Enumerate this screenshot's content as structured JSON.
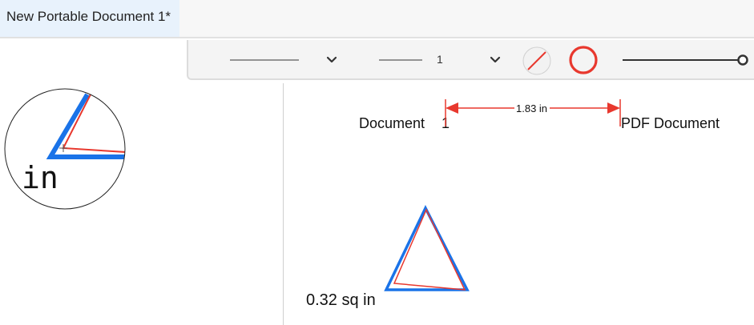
{
  "tab": {
    "title": "New Portable Document 1*"
  },
  "toolbar": {
    "line_width_value": "1",
    "stroke_color": "#e8382e",
    "border_color": "#e8382e"
  },
  "magnifier": {
    "label": "in"
  },
  "document": {
    "text_left": "Document",
    "text_mid_char": "1",
    "text_right": "PDF Document",
    "measure_label": "1.83 in",
    "area_label": "0.32 sq in"
  },
  "colors": {
    "accent_blue": "#1a73e8",
    "annotation_red": "#e8382e"
  }
}
